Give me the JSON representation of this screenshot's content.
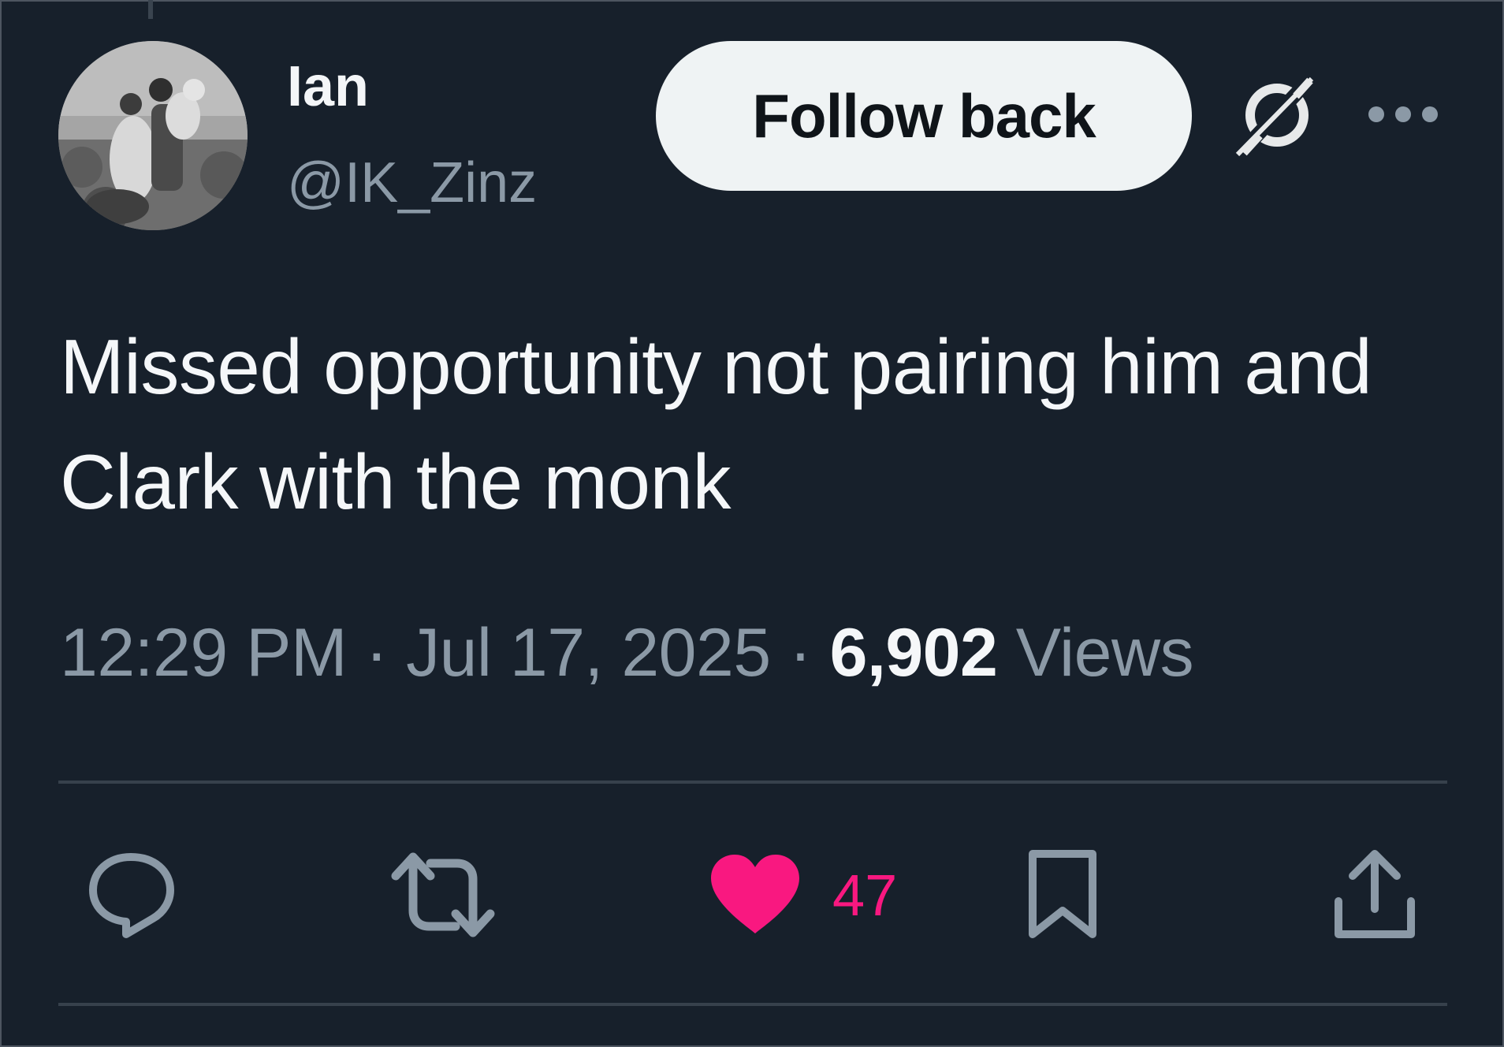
{
  "author": {
    "display_name": "Ian",
    "handle": "@IK_Zinz"
  },
  "follow_button": {
    "label": "Follow back"
  },
  "icons": {
    "grok": "grok-icon",
    "more": "more-horizontal-icon",
    "reply": "reply-icon",
    "retweet": "retweet-icon",
    "like": "heart-icon",
    "bookmark": "bookmark-icon",
    "share": "share-icon"
  },
  "tweet": {
    "text": "Missed opportunity not pairing him and Clark with the monk",
    "time": "12:29 PM",
    "date": "Jul 17, 2025",
    "separator": "·",
    "views_count": "6,902",
    "views_label": "Views"
  },
  "actions": {
    "like_count": "47"
  },
  "colors": {
    "background": "#17202b",
    "like": "#f91880",
    "muted": "#8b99a6",
    "text": "#f5f7f9",
    "button_bg": "#eff3f4"
  }
}
